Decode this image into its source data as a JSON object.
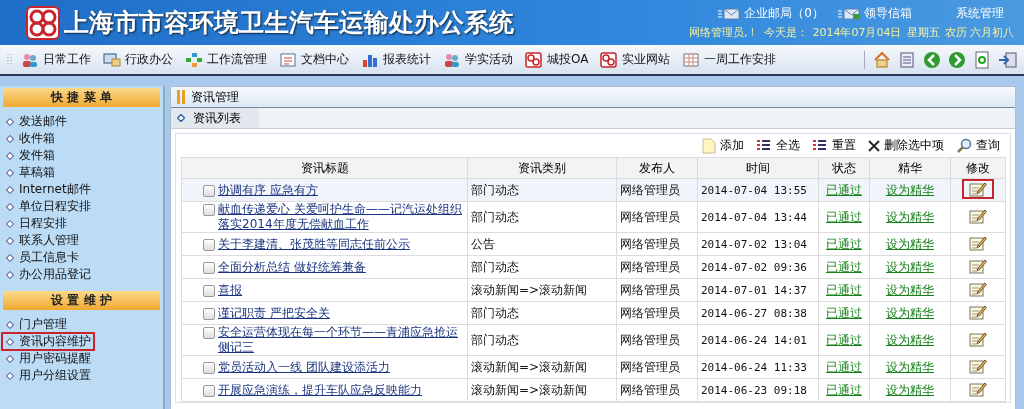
{
  "header": {
    "title": "上海市市容环境卫生汽车运输处办公系统",
    "links": [
      {
        "label": "企业邮局（0）",
        "kind": "mail"
      },
      {
        "label": "领导信箱",
        "kind": "leader"
      },
      {
        "label": "系统管理",
        "kind": "plain"
      }
    ],
    "user": "网络管理员,！",
    "today_label": "今天是：",
    "date": "2014年07月04日",
    "weekday": "星期五",
    "lunar": "农历 六月初八"
  },
  "toolbar": {
    "items": [
      {
        "label": "日常工作",
        "kind": "people"
      },
      {
        "label": "行政办公",
        "kind": "computer"
      },
      {
        "label": "工作流管理",
        "kind": "flow"
      },
      {
        "label": "文档中心",
        "kind": "doc"
      },
      {
        "label": "报表统计",
        "kind": "chart"
      },
      {
        "label": "学实活动",
        "kind": "people"
      },
      {
        "label": "城投OA",
        "kind": "logo"
      },
      {
        "label": "实业网站",
        "kind": "logo"
      },
      {
        "label": "一周工作安排",
        "kind": "calendar"
      }
    ]
  },
  "sidebar": {
    "sections": [
      {
        "title": "快 捷 菜 单",
        "items": [
          {
            "label": "发送邮件",
            "highlighted": false
          },
          {
            "label": "收件箱",
            "highlighted": false
          },
          {
            "label": "发件箱",
            "highlighted": false
          },
          {
            "label": "草稿箱",
            "highlighted": false
          },
          {
            "label": "Internet邮件",
            "highlighted": false
          },
          {
            "label": "单位日程安排",
            "highlighted": false
          },
          {
            "label": "日程安排",
            "highlighted": false
          },
          {
            "label": "联系人管理",
            "highlighted": false
          },
          {
            "label": "员工信息卡",
            "highlighted": false
          },
          {
            "label": "办公用品登记",
            "highlighted": false
          }
        ]
      },
      {
        "title": "设 置 维 护",
        "items": [
          {
            "label": "门户管理",
            "highlighted": false
          },
          {
            "label": "资讯内容维护",
            "highlighted": true
          },
          {
            "label": "用户密码提醒",
            "highlighted": false
          },
          {
            "label": "用户分组设置",
            "highlighted": false
          }
        ]
      }
    ]
  },
  "main": {
    "title": "资讯管理",
    "tab": "资讯列表",
    "actions": [
      {
        "label": "添加",
        "kind": "add"
      },
      {
        "label": "全选",
        "kind": "selectall"
      },
      {
        "label": "重置",
        "kind": "reset"
      },
      {
        "label": "删除选中项",
        "kind": "delete"
      },
      {
        "label": "查询",
        "kind": "search"
      }
    ],
    "table": {
      "columns": [
        "资讯标题",
        "资讯类别",
        "发布人",
        "时间",
        "状态",
        "精华",
        "修改"
      ],
      "rows": [
        {
          "title": "协调有序 应急有方",
          "category": "部门动态",
          "publisher": "网络管理员",
          "time": "2014-07-04 13:55",
          "status": "已通过",
          "featured": "设为精华",
          "checked": false,
          "selected": true,
          "edit_highlighted": true
        },
        {
          "title": "献血传递爱心 关爱呵护生命——记汽运处组织落实2014年度无偿献血工作",
          "category": "部门动态",
          "publisher": "网络管理员",
          "time": "2014-07-04 13:44",
          "status": "已通过",
          "featured": "设为精华",
          "checked": false,
          "selected": false,
          "edit_highlighted": false
        },
        {
          "title": "关于李建清、张茂胜等同志任前公示",
          "category": "公告",
          "publisher": "网络管理员",
          "time": "2014-07-02 13:04",
          "status": "已通过",
          "featured": "设为精华",
          "checked": false,
          "selected": false,
          "edit_highlighted": false
        },
        {
          "title": "全面分析总结 做好统筹兼备",
          "category": "部门动态",
          "publisher": "网络管理员",
          "time": "2014-07-02 09:36",
          "status": "已通过",
          "featured": "设为精华",
          "checked": false,
          "selected": false,
          "edit_highlighted": false
        },
        {
          "title": "喜报",
          "category": "滚动新闻=>滚动新闻",
          "publisher": "网络管理员",
          "time": "2014-07-01 14:37",
          "status": "已通过",
          "featured": "设为精华",
          "checked": false,
          "selected": false,
          "edit_highlighted": false
        },
        {
          "title": "谨记职责 严把安全关",
          "category": "部门动态",
          "publisher": "网络管理员",
          "time": "2014-06-27 08:38",
          "status": "已通过",
          "featured": "设为精华",
          "checked": false,
          "selected": false,
          "edit_highlighted": false
        },
        {
          "title": "安全运营体现在每一个环节——青浦应急抢运侧记三",
          "category": "部门动态",
          "publisher": "网络管理员",
          "time": "2014-06-24 14:01",
          "status": "已通过",
          "featured": "设为精华",
          "checked": false,
          "selected": false,
          "edit_highlighted": false
        },
        {
          "title": "党员活动入一线 团队建设添活力",
          "category": "滚动新闻=>滚动新闻",
          "publisher": "网络管理员",
          "time": "2014-06-24 11:33",
          "status": "已通过",
          "featured": "设为精华",
          "checked": false,
          "selected": false,
          "edit_highlighted": false
        },
        {
          "title": "开展应急演练，提升车队应急反映能力",
          "category": "滚动新闻=>滚动新闻",
          "publisher": "网络管理员",
          "time": "2014-06-23 09:18",
          "status": "已通过",
          "featured": "设为精华",
          "checked": false,
          "selected": false,
          "edit_highlighted": false
        }
      ]
    }
  }
}
